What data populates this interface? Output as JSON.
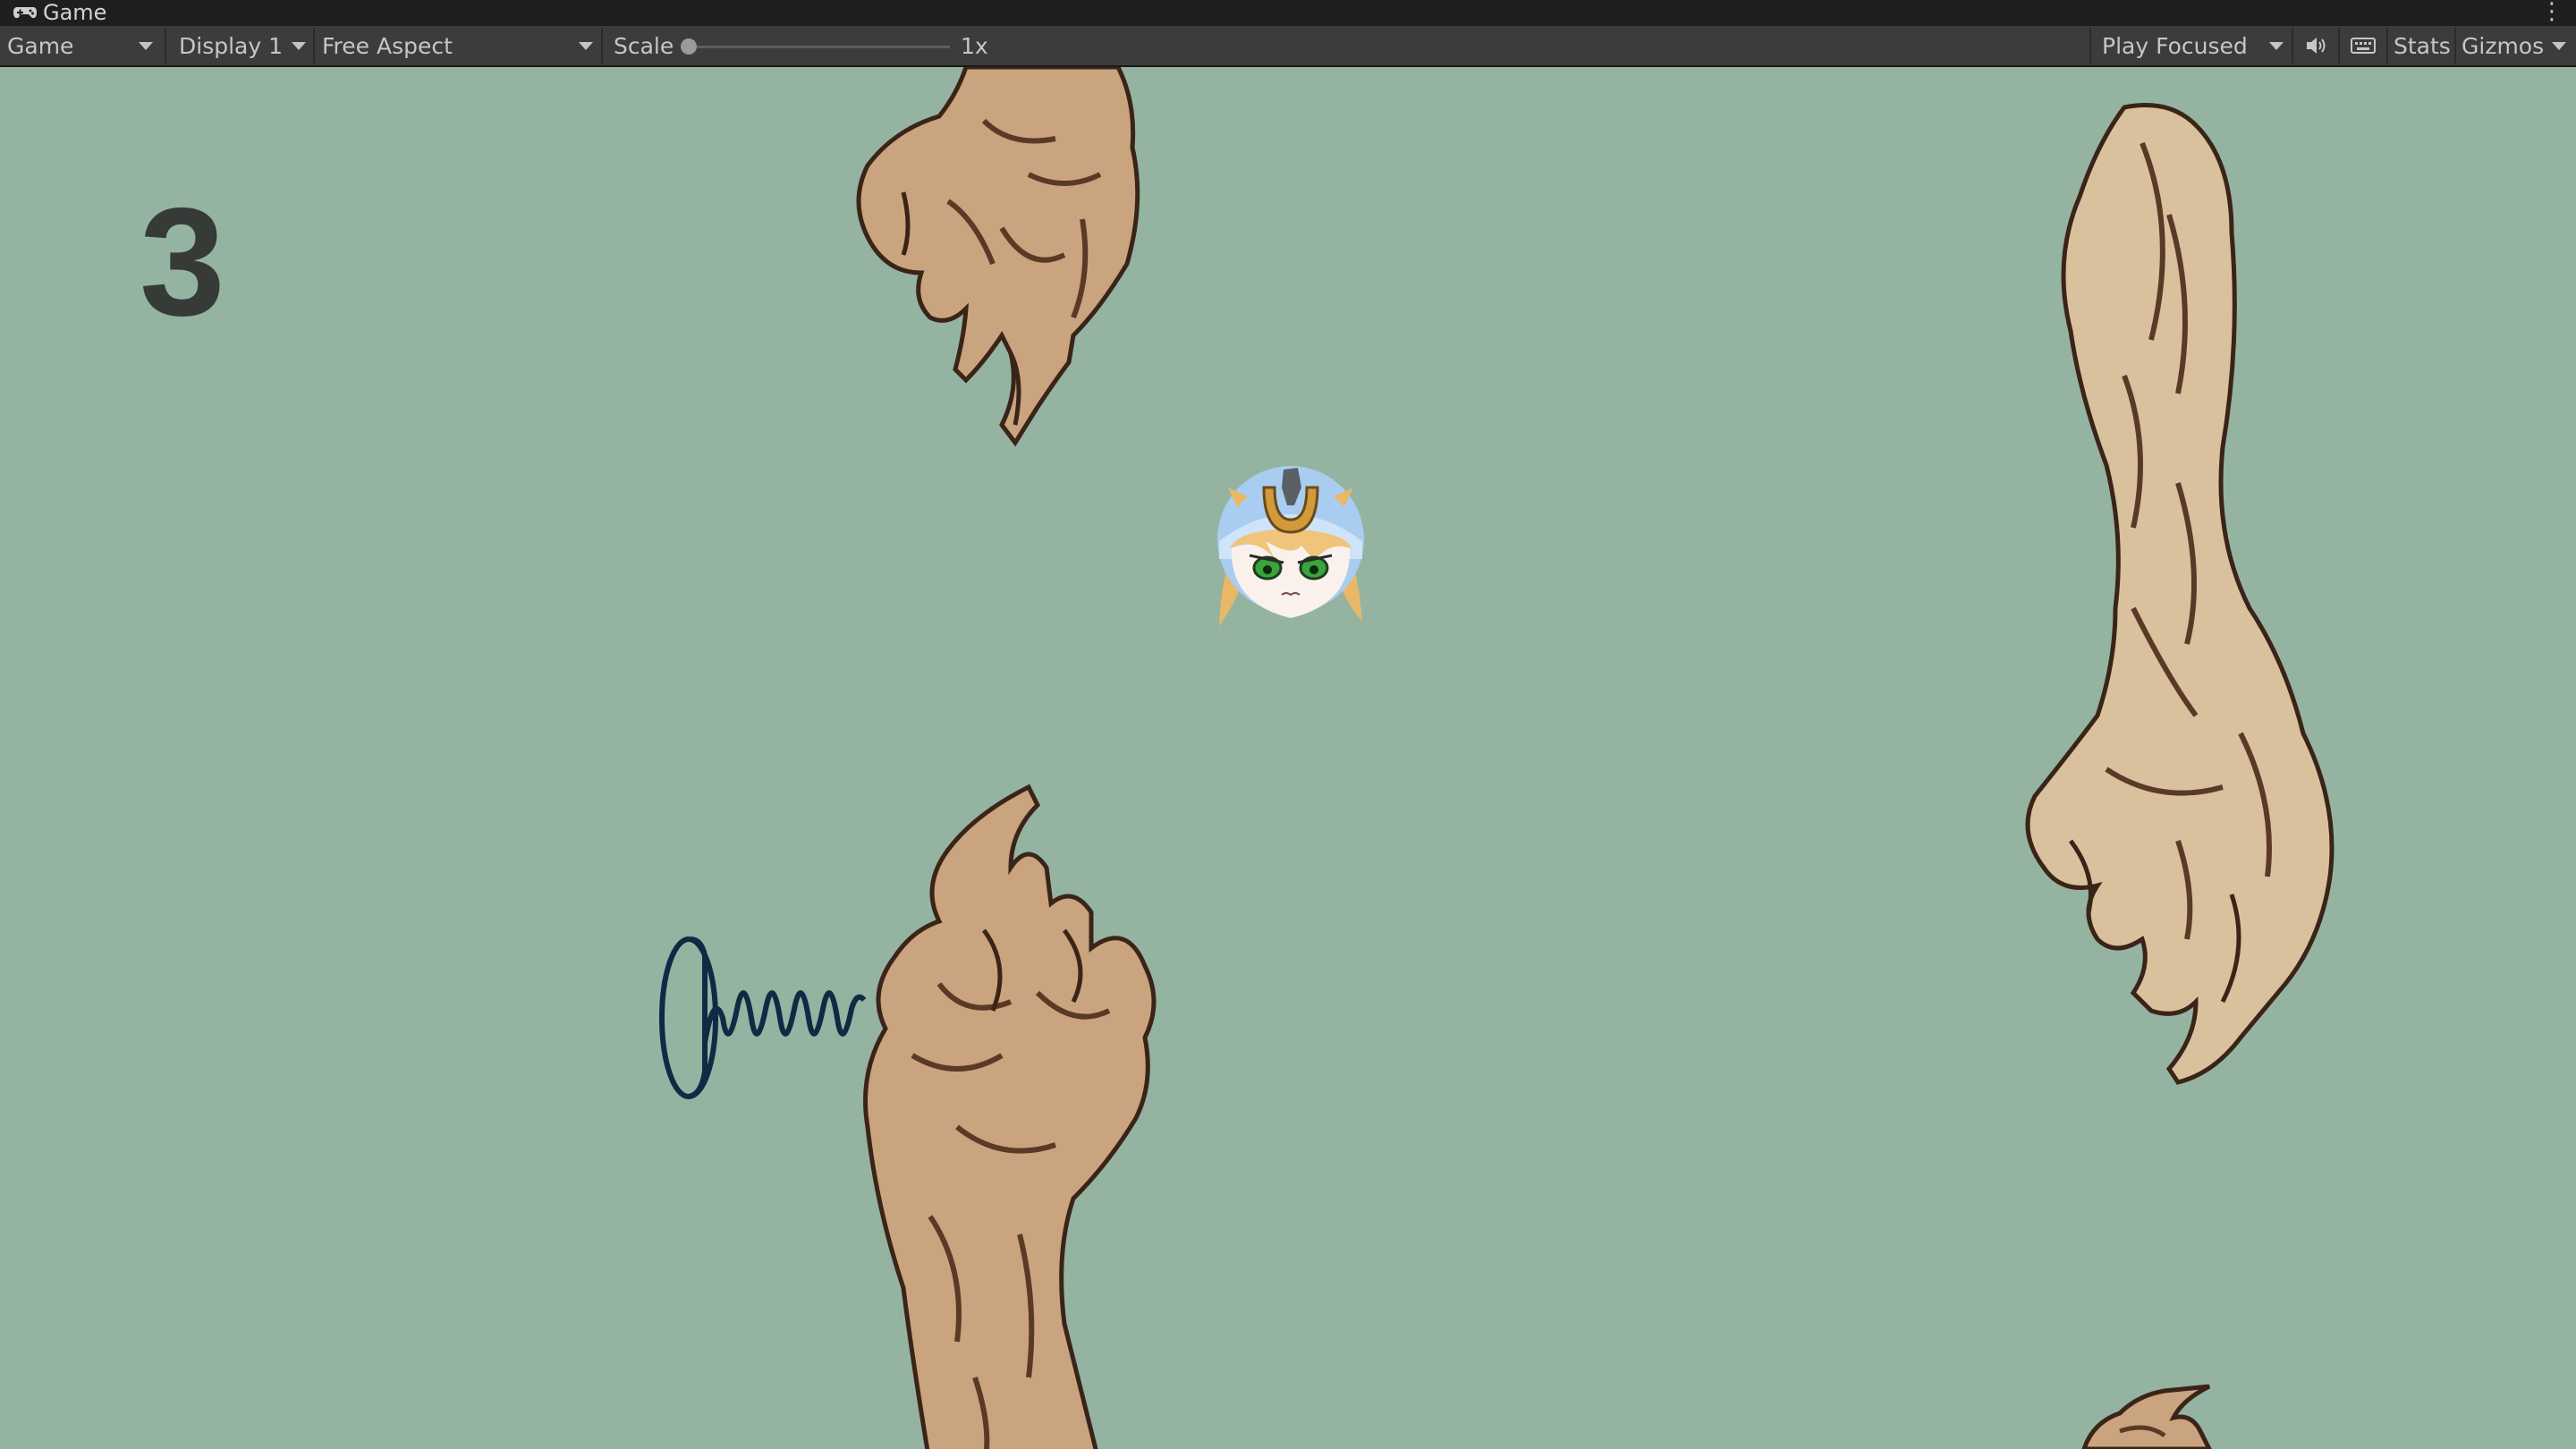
{
  "window": {
    "tab_label": "Game",
    "tab_icon": "gamepad-icon",
    "menu_icon": "kebab-menu-icon"
  },
  "toolbar": {
    "view_mode": "Game",
    "display": "Display 1",
    "aspect": "Free Aspect",
    "scale_label": "Scale",
    "scale_value": "1x",
    "scale_slider_position": 0,
    "play_mode": "Play Focused",
    "mute_icon": "speaker-icon",
    "keyboard_icon": "keyboard-icon",
    "stats_label": "Stats",
    "gizmos_label": "Gizmos"
  },
  "game": {
    "score": "3",
    "background_color": "#95b3a1",
    "player_sprite": "anime-girl-head-with-horseshoe-helmet",
    "obstacle_sprite": "zombie-claw-hand",
    "powerup_sprite": "coil-spring"
  },
  "colors": {
    "titlebar_bg": "#1e1e1e",
    "toolbar_bg": "#3c3c3c",
    "toolbar_text": "#c6c6c6",
    "score_text": "#363b37",
    "claw_skin": "#c9a47e",
    "claw_outline": "#3a2418",
    "spring_stroke": "#102a44"
  }
}
